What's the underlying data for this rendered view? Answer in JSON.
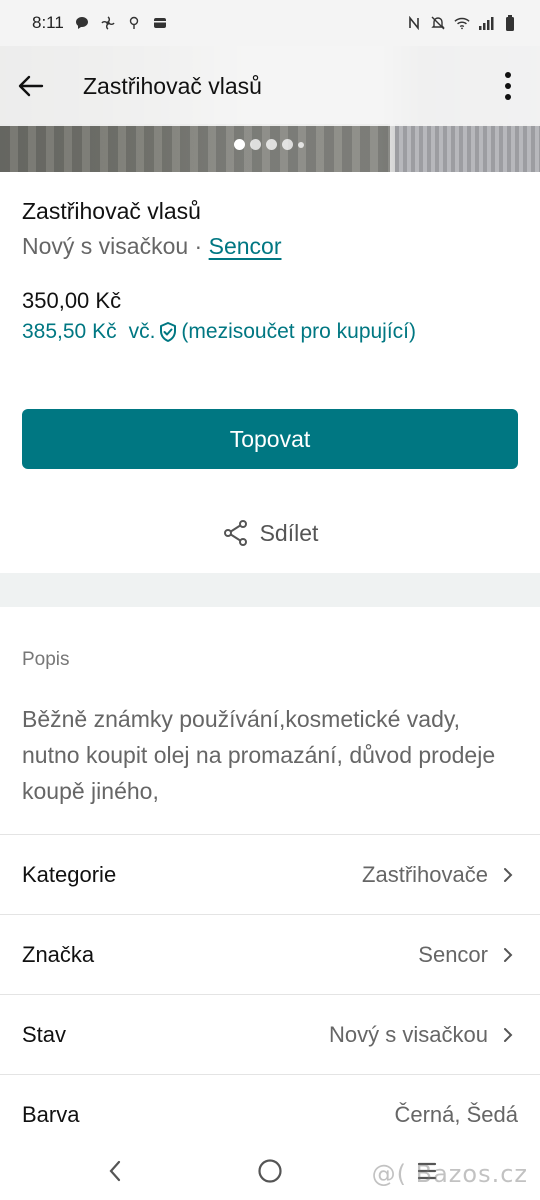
{
  "status_bar": {
    "time": "8:11",
    "left_icons": [
      "message-bubble-icon",
      "fan-icon",
      "location-pin-icon",
      "wallet-icon"
    ],
    "right_icons": [
      "nfc-icon",
      "mute-icon",
      "wifi-icon",
      "signal-icon",
      "battery-icon"
    ]
  },
  "app_bar": {
    "title": "Zastřihovač vlasů",
    "back_icon": "arrow-left-icon",
    "menu_icon": "more-vertical-icon"
  },
  "gallery": {
    "current_index": 1,
    "dot_count": 5
  },
  "item": {
    "title": "Zastřihovač vlasů",
    "condition": "Nový s visačkou",
    "separator": " · ",
    "brand": "Sencor",
    "price": "350,00 Kč",
    "buyer_price": "385,50 Kč",
    "buyer_price_suffix": "vč.",
    "buyer_price_note": "(mezisoučet pro kupující)"
  },
  "actions": {
    "promote_label": "Topovat",
    "share_label": "Sdílet"
  },
  "description": {
    "heading": "Popis",
    "text": "Běžně známky používání,kosmetické vady, nutno koupit olej na promazání, důvod prodeje koupě jiného,"
  },
  "attributes": [
    {
      "label": "Kategorie",
      "value": "Zastřihovače"
    },
    {
      "label": "Značka",
      "value": "Sencor"
    },
    {
      "label": "Stav",
      "value": "Nový s visačkou"
    },
    {
      "label": "Barva",
      "value": "Černá, Šedá"
    }
  ],
  "watermark": "@( Bazos.cz",
  "colors": {
    "accent": "#007782",
    "text_primary": "#111111",
    "text_secondary": "#666666"
  }
}
